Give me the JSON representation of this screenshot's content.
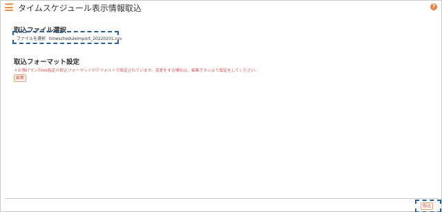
{
  "header": {
    "title": "タイムスケジュール表示情報取込",
    "menu_icon": "hamburger-menu-icon",
    "help_icon": "question-icon",
    "help_symbol": "?"
  },
  "file_section": {
    "heading": "取込ファイル選択",
    "file_button_label": "ファイルを選択",
    "file_name": "timescheduleimport_20220201.csv"
  },
  "format_section": {
    "heading": "取込フォーマット設定",
    "note": "＊お預けマンTime指定の取込フォーマットがデフォルトで設定されています。変更をする場合は、編集ボタンより設定をしてください。",
    "edit_label": "編集"
  },
  "footer": {
    "import_label": "取込"
  },
  "colors": {
    "accent": "#ff8a3d",
    "note_red": "#d9534f",
    "highlight_dash": "#1f5fa8"
  }
}
